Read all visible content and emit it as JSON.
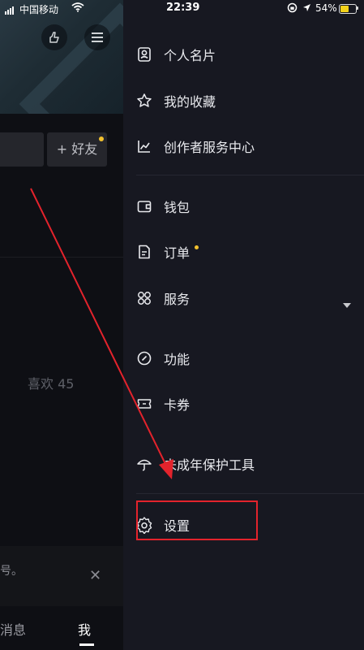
{
  "status_bar": {
    "carrier": "中国移动",
    "time": "22:39",
    "battery_percent": "54%",
    "battery_level": 0.54
  },
  "background": {
    "add_friend_label": "+ 好友",
    "likes_label": "喜欢 45",
    "notice_text": "号。",
    "tabs": {
      "messages": "消息",
      "me": "我"
    }
  },
  "menu": {
    "items": [
      {
        "label": "个人名片",
        "icon": "id-card-icon"
      },
      {
        "label": "我的收藏",
        "icon": "star-icon"
      },
      {
        "label": "创作者服务中心",
        "icon": "chart-line-icon"
      },
      {
        "label": "钱包",
        "icon": "wallet-icon"
      },
      {
        "label": "订单",
        "icon": "document-icon"
      },
      {
        "label": "服务",
        "icon": "grid-icon"
      },
      {
        "label": "功能",
        "icon": "link-icon"
      },
      {
        "label": "卡券",
        "icon": "ticket-icon"
      },
      {
        "label": "未成年保护工具",
        "icon": "umbrella-icon"
      },
      {
        "label": "设置",
        "icon": "gear-icon"
      }
    ]
  },
  "colors": {
    "drawer_bg": "#171821",
    "highlight": "#e3232c",
    "badge": "#f2c12e"
  }
}
